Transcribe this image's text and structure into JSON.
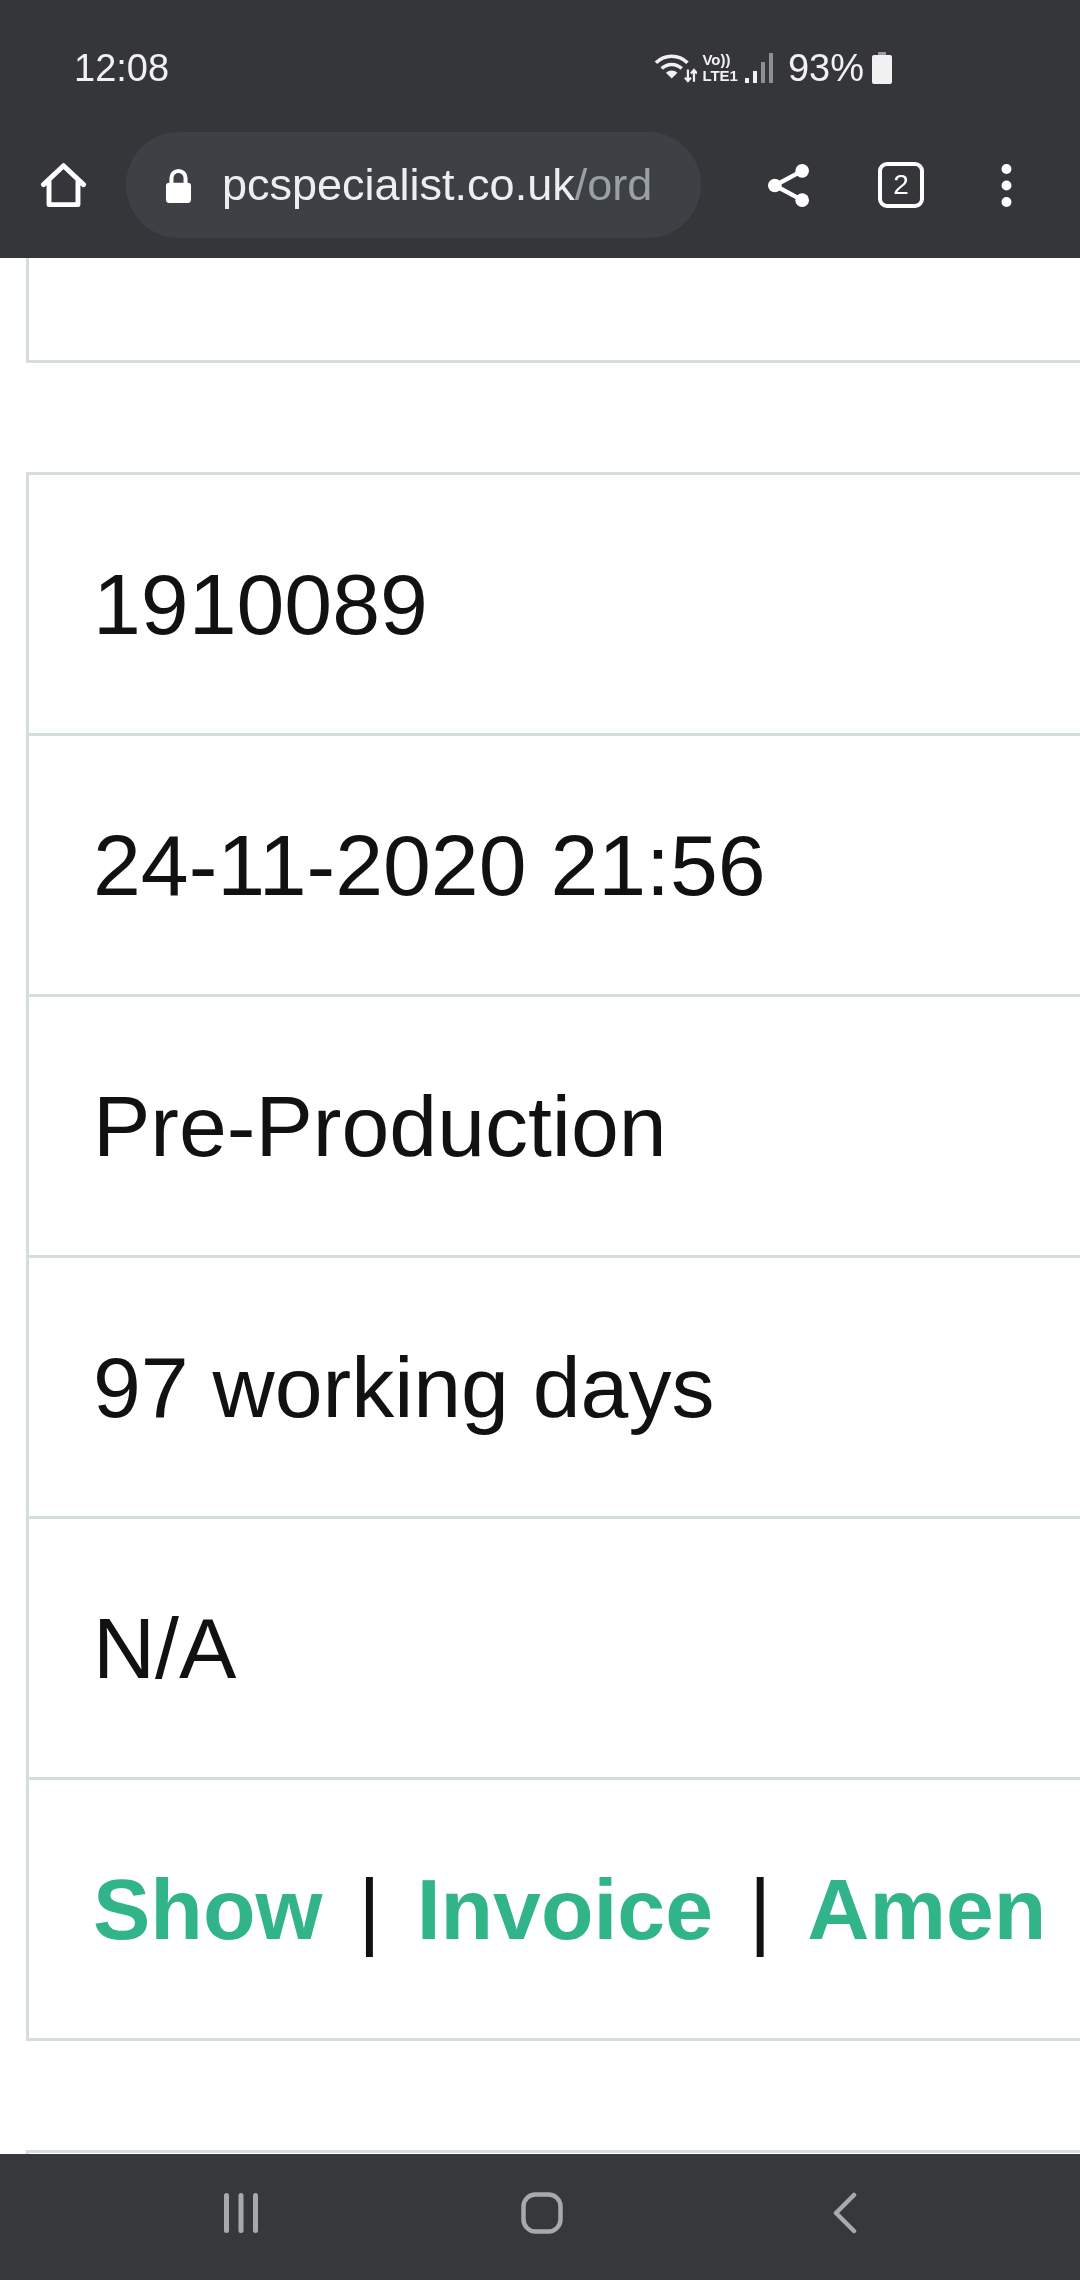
{
  "status_bar": {
    "time": "12:08",
    "volte_top": "Vo))",
    "volte_bottom": "LTE1",
    "battery_percent": "93%"
  },
  "browser_toolbar": {
    "url_domain": "pcspecialist.co.uk",
    "url_path": "/ord",
    "tab_count": "2"
  },
  "order_details": {
    "rows": [
      {
        "kind": "value",
        "text": "1910089"
      },
      {
        "kind": "value",
        "text": "24-11-2020 21:56"
      },
      {
        "kind": "value",
        "text": "Pre-Production"
      },
      {
        "kind": "value",
        "text": "97 working days"
      },
      {
        "kind": "value",
        "text": "N/A"
      },
      {
        "kind": "actions",
        "items": [
          {
            "kind": "link",
            "text": "Show"
          },
          {
            "kind": "separator",
            "text": "|"
          },
          {
            "kind": "link",
            "text": "Invoice"
          },
          {
            "kind": "separator",
            "text": "|"
          },
          {
            "kind": "link",
            "text": "Amen"
          }
        ]
      }
    ]
  }
}
